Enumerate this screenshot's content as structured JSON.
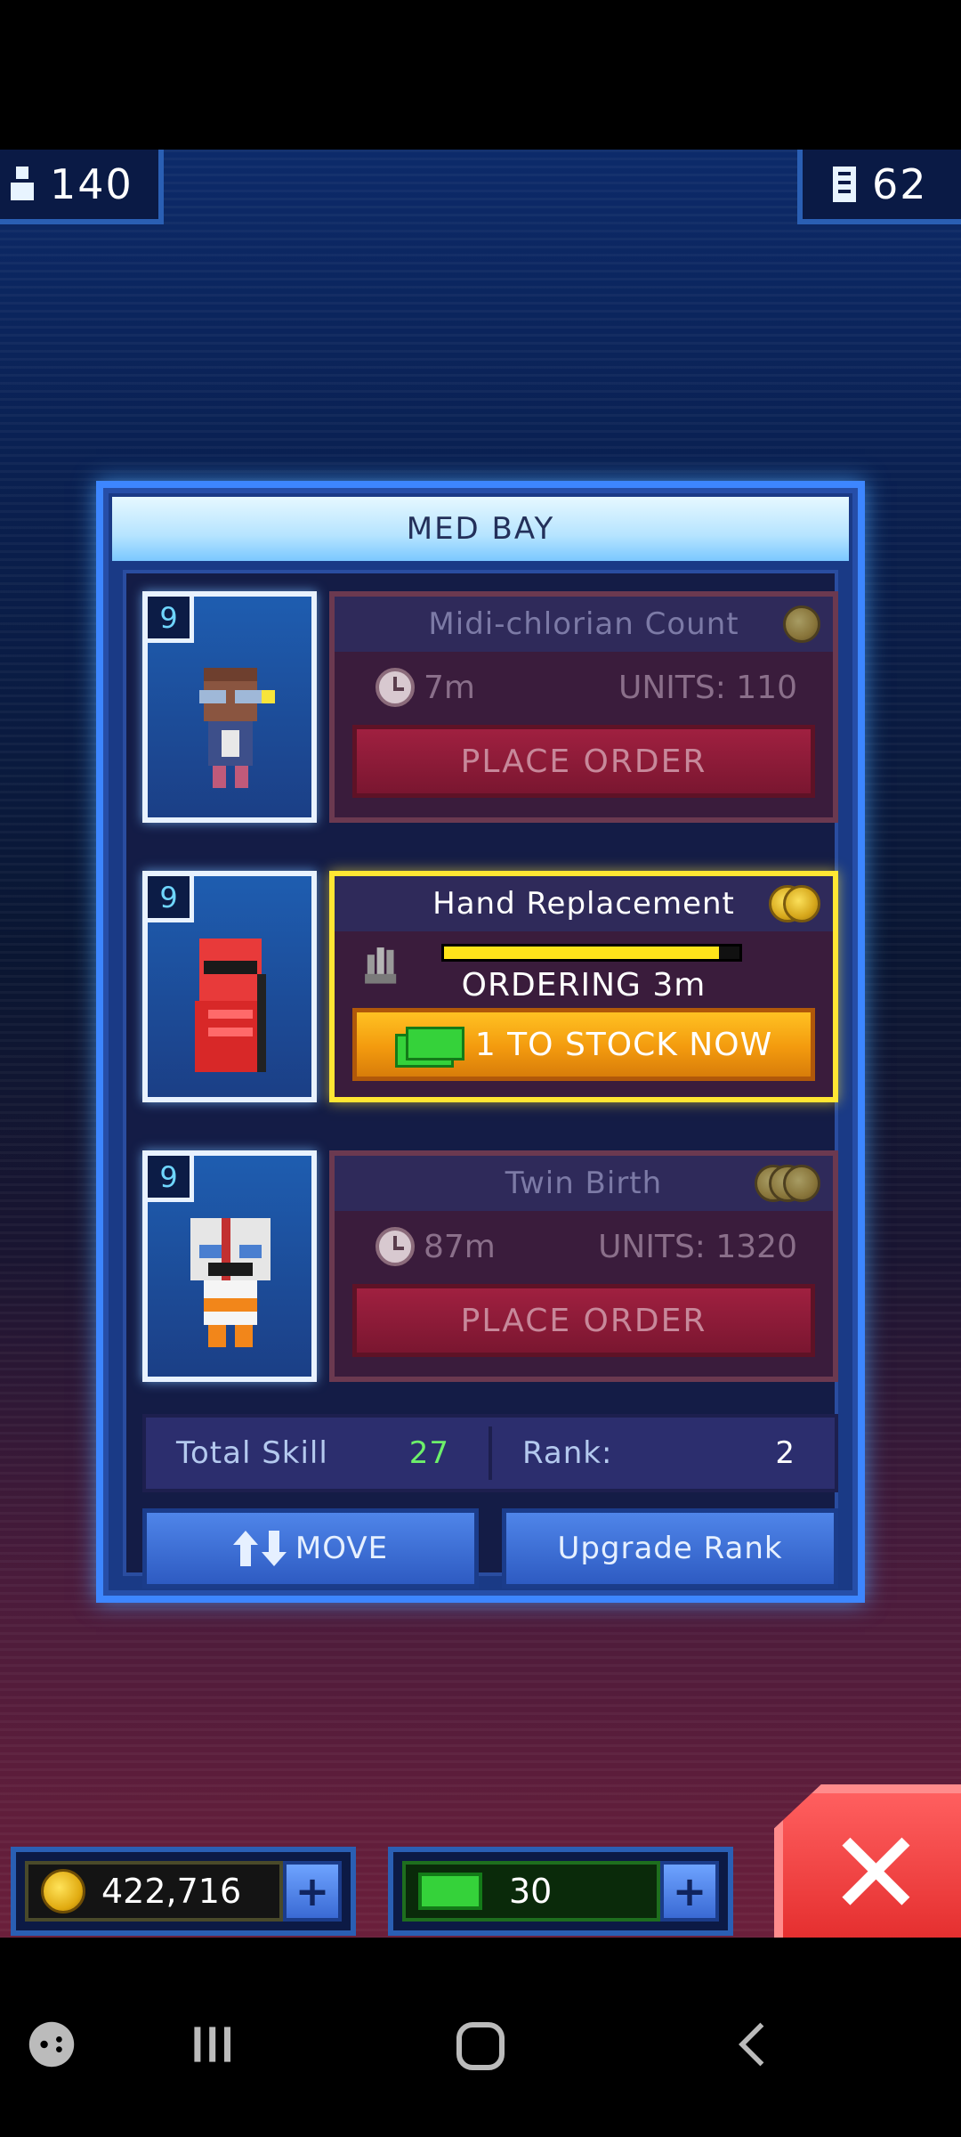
{
  "top_counters": {
    "population": "140",
    "floors": "62",
    "population_icon": "person-icon",
    "floors_icon": "building-icon"
  },
  "panel": {
    "title": "MED BAY",
    "rows": [
      {
        "level": "9",
        "task_title": "Midi-chlorian Count",
        "time": "7m",
        "units": "UNITS: 110",
        "button": "PLACE ORDER",
        "state": "idle",
        "coins": 1
      },
      {
        "level": "9",
        "task_title": "Hand Replacement",
        "ordering": "ORDERING 3m",
        "progress": 0.93,
        "button": "1 TO STOCK NOW",
        "state": "active",
        "coins": 2
      },
      {
        "level": "9",
        "task_title": "Twin Birth",
        "time": "87m",
        "units": "UNITS: 1320",
        "button": "PLACE ORDER",
        "state": "idle",
        "coins": 3
      }
    ],
    "stats": {
      "skill_label": "Total Skill",
      "skill_value": "27",
      "rank_label": "Rank:",
      "rank_value": "2"
    },
    "buttons": {
      "move_label": "MOVE",
      "upgrade_label": "Upgrade Rank"
    }
  },
  "hud": {
    "coins": "422,716",
    "bux": "30",
    "plus": "+",
    "close": "✕"
  },
  "colors": {
    "accent_blue": "#3d86ff",
    "active_yellow": "#ffe633",
    "order_red": "#a02040",
    "stock_orange": "#f39a0e",
    "skill_green": "#6df06a"
  }
}
